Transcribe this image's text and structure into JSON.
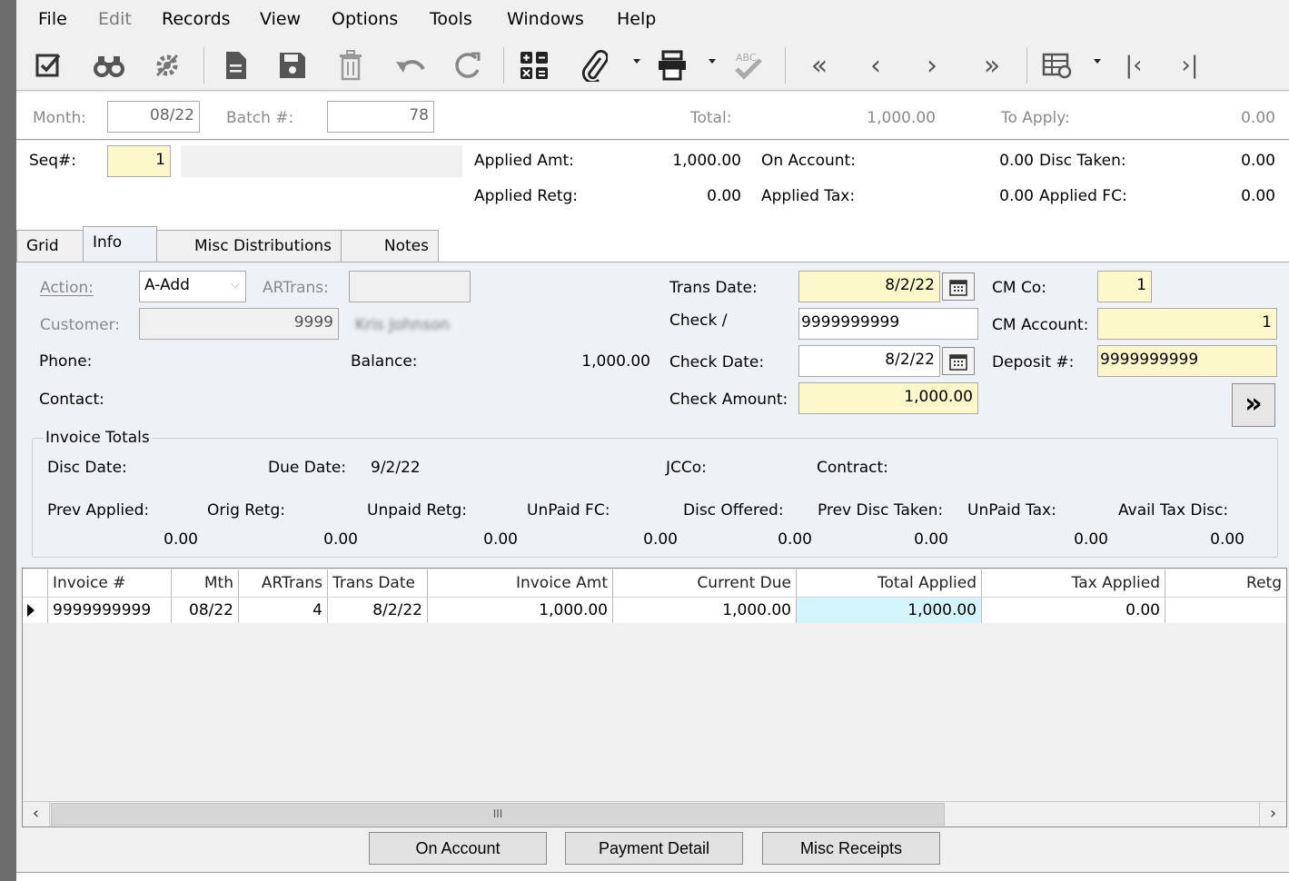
{
  "menu": [
    "File",
    "Edit",
    "Records",
    "View",
    "Options",
    "Tools",
    "Windows",
    "Help"
  ],
  "toolbar": {
    "icons": [
      "edit-check-icon",
      "binoculars-icon",
      "settings-icon",
      "new-document-icon",
      "save-icon",
      "delete-icon",
      "undo-icon",
      "refresh-icon",
      "calculator-icon",
      "attachment-icon",
      "print-icon",
      "spellcheck-icon",
      "first-record-icon",
      "previous-record-icon",
      "next-record-icon",
      "last-record-icon",
      "grid-options-icon",
      "first-icon",
      "last-icon"
    ]
  },
  "batch": {
    "month_label": "Month:",
    "month_value": "08/22",
    "batch_label": "Batch #:",
    "batch_value": "78",
    "total_label": "Total:",
    "total_value": "1,000.00",
    "to_apply_label": "To Apply:",
    "to_apply_value": "0.00"
  },
  "header": {
    "seq_label": "Seq#:",
    "seq_value": "1",
    "applied_amt_label": "Applied Amt:",
    "applied_amt_value": "1,000.00",
    "on_account_label": "On Account:",
    "on_account_value": "0.00",
    "disc_taken_label": "Disc Taken:",
    "disc_taken_value": "0.00",
    "applied_retg_label": "Applied Retg:",
    "applied_retg_value": "0.00",
    "applied_tax_label": "Applied Tax:",
    "applied_tax_value": "0.00",
    "applied_fc_label": "Applied FC:",
    "applied_fc_value": "0.00"
  },
  "tabs": [
    "Grid",
    "Info",
    "Misc Distributions",
    "Notes"
  ],
  "info": {
    "action_label": "Action:",
    "action_value": "A-Add",
    "artrans_label": "ARTrans:",
    "artrans_value": "",
    "customer_label": "Customer:",
    "customer_value": "9999",
    "customer_name": "Kris Johnson",
    "phone_label": "Phone:",
    "balance_label": "Balance:",
    "balance_value": "1,000.00",
    "contact_label": "Contact:",
    "trans_date_label": "Trans Date:",
    "trans_date_value": "8/2/22",
    "check_label": "Check /",
    "check_value": "9999999999",
    "check_date_label": "Check Date:",
    "check_date_value": "8/2/22",
    "check_amount_label": "Check Amount:",
    "check_amount_value": "1,000.00",
    "cm_co_label": "CM Co:",
    "cm_co_value": "1",
    "cm_account_label": "CM Account:",
    "cm_account_value": "1",
    "deposit_label": "Deposit #:",
    "deposit_value": "9999999999",
    "more_button": "»"
  },
  "invoice_totals": {
    "title": "Invoice Totals",
    "disc_date_label": "Disc Date:",
    "due_date_label": "Due Date:",
    "due_date_value": "9/2/22",
    "jcco_label": "JCCo:",
    "contract_label": "Contract:",
    "labels": [
      "Prev Applied:",
      "Orig Retg:",
      "Unpaid Retg:",
      "UnPaid FC:",
      "Disc Offered:",
      "Prev Disc Taken:",
      "UnPaid Tax:",
      "Avail Tax Disc:"
    ],
    "values": [
      "0.00",
      "0.00",
      "0.00",
      "0.00",
      "0.00",
      "0.00",
      "0.00",
      "0.00"
    ]
  },
  "grid": {
    "columns": [
      "Invoice #",
      "Mth",
      "ARTrans",
      "Trans Date",
      "Invoice Amt",
      "Current Due",
      "Total Applied",
      "Tax Applied",
      "Retg"
    ],
    "rows": [
      [
        "9999999999",
        "08/22",
        "4",
        "8/2/22",
        "1,000.00",
        "1,000.00",
        "1,000.00",
        "0.00",
        ""
      ]
    ],
    "scroll_thumb": "III"
  },
  "buttons": {
    "on_account": "On Account",
    "payment_detail": "Payment Detail",
    "misc_receipts": "Misc Receipts"
  },
  "colors": {
    "yellow_field": "#fdf8c9",
    "panel": "#eef2f6",
    "selected_cell": "#d4f4fb"
  }
}
